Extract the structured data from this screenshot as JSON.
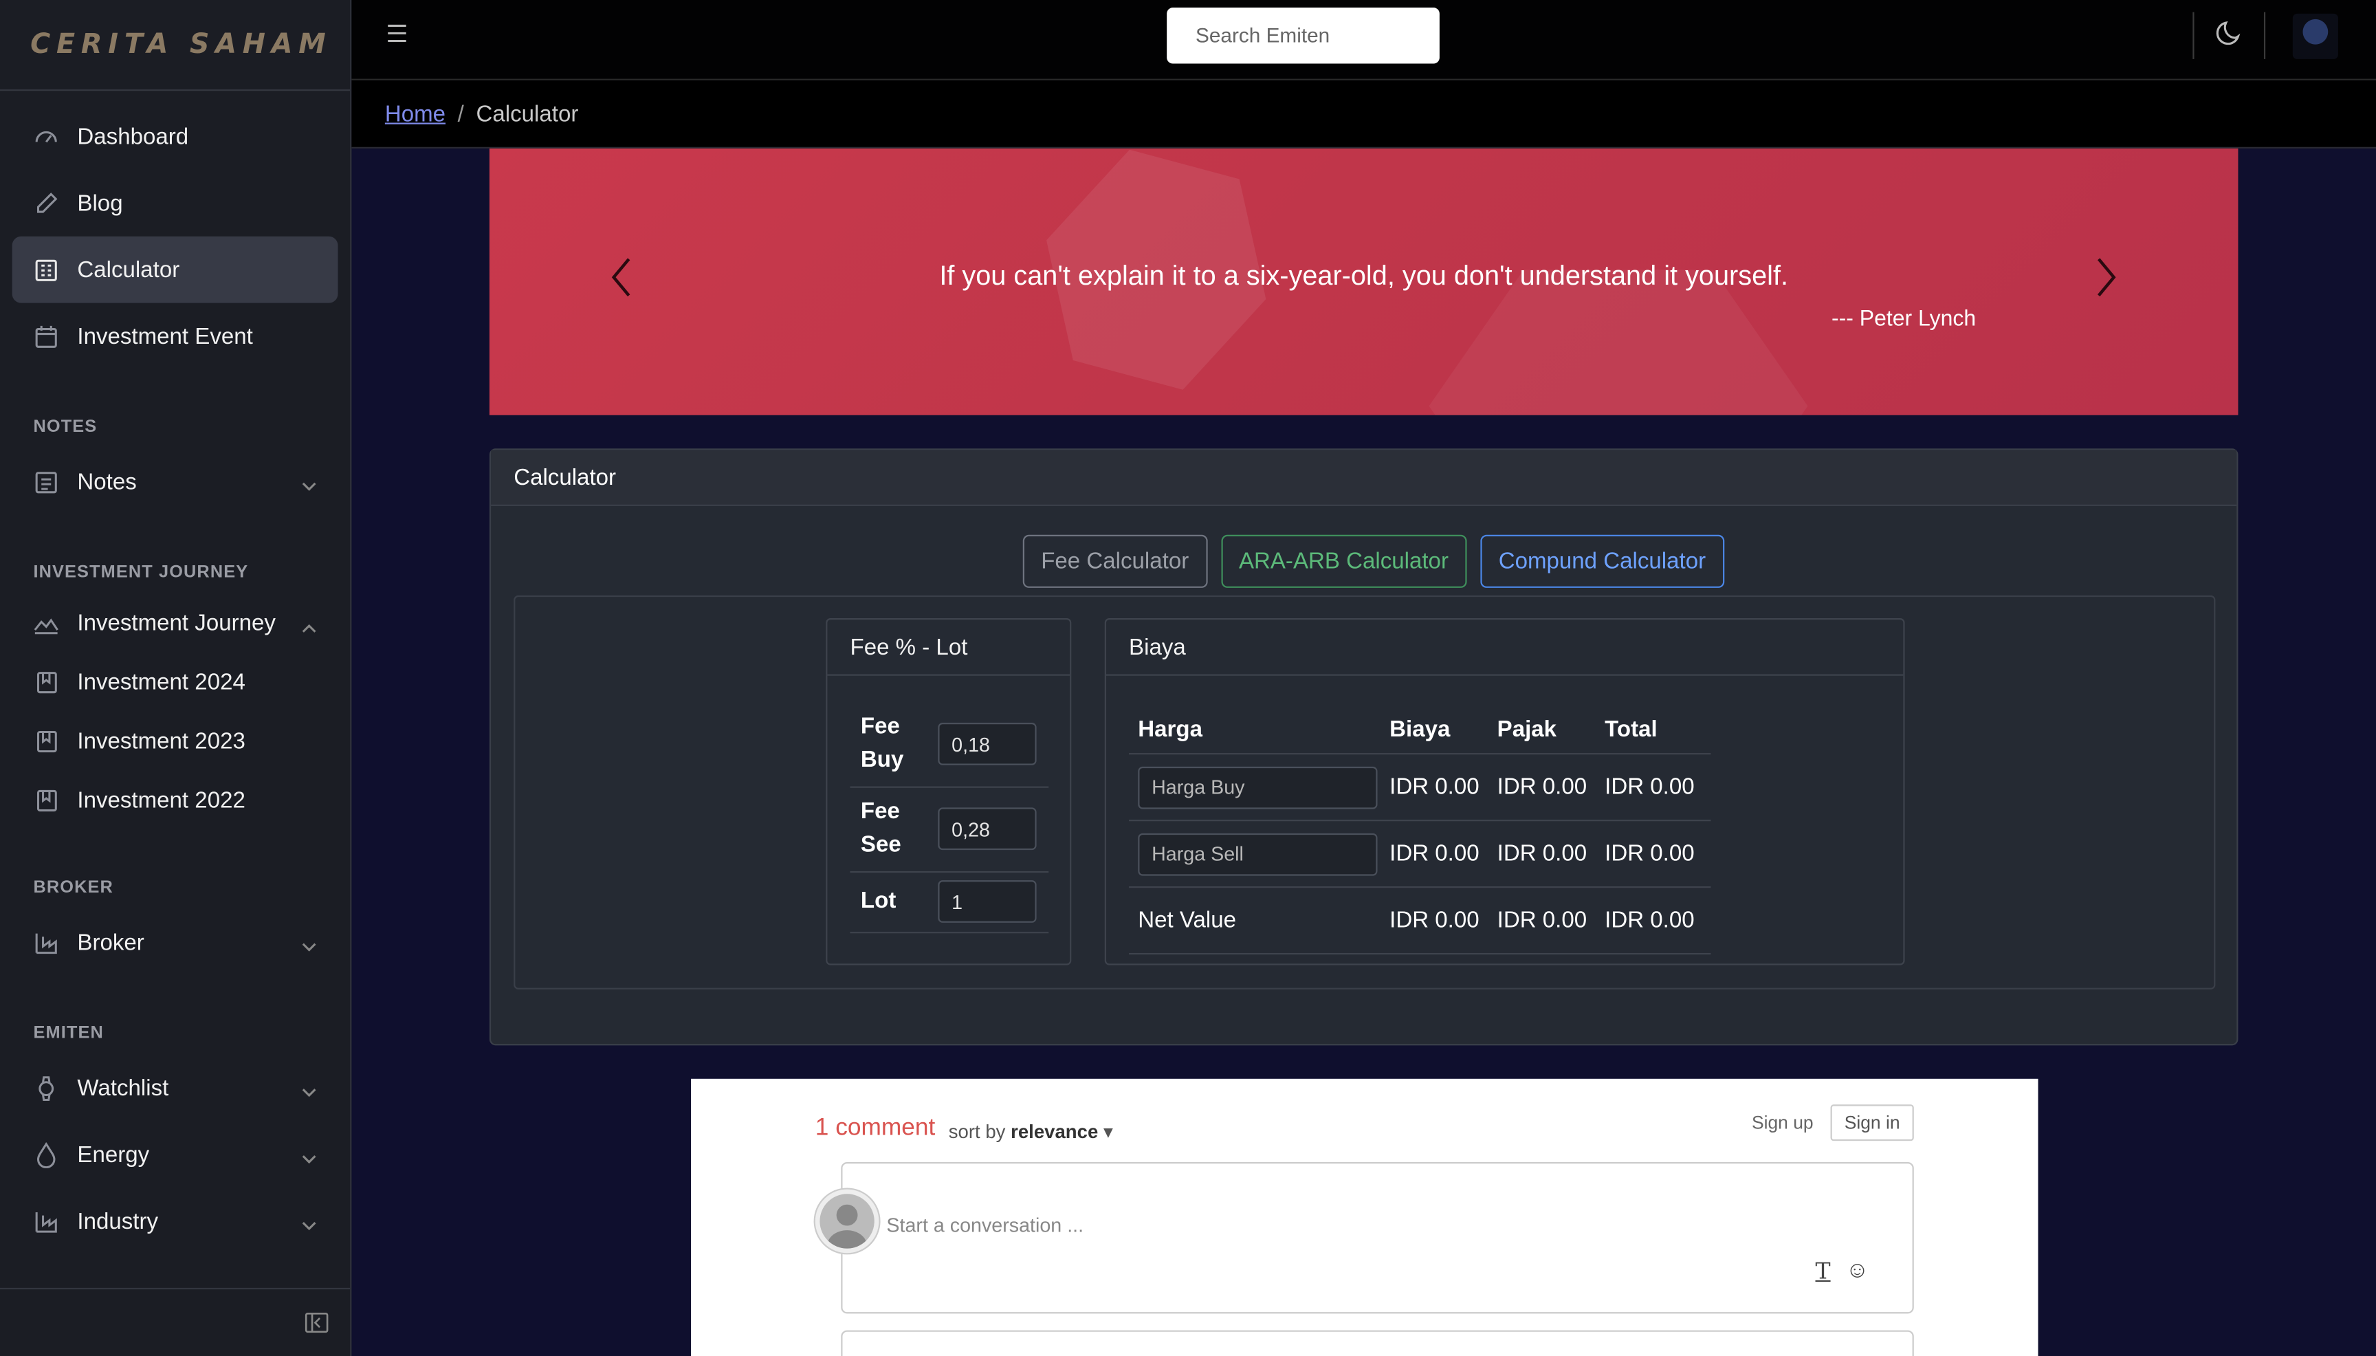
{
  "brand": "CERITA SAHAM",
  "sidebar": {
    "main": [
      {
        "label": "Dashboard"
      },
      {
        "label": "Blog"
      },
      {
        "label": "Calculator"
      },
      {
        "label": "Investment Event"
      }
    ],
    "sections": {
      "notes": "NOTES",
      "journey": "INVESTMENT JOURNEY",
      "broker": "BROKER",
      "emiten": "EMITEN"
    },
    "notes": "Notes",
    "journey": "Investment Journey",
    "journey_items": [
      "Investment 2024",
      "Investment 2023",
      "Investment 2022"
    ],
    "broker": "Broker",
    "emiten_items": [
      "Watchlist",
      "Energy",
      "Industry"
    ]
  },
  "header": {
    "search_placeholder": "Search Emiten"
  },
  "breadcrumb": {
    "home": "Home",
    "sep": "/",
    "current": "Calculator"
  },
  "banner": {
    "quote": "If you can't explain it to a six-year-old, you don't understand it yourself.",
    "author": "--- Peter Lynch"
  },
  "calculator": {
    "title": "Calculator",
    "tabs": [
      "Fee Calculator",
      "ARA-ARB Calculator",
      "Compund Calculator"
    ],
    "fee_card": {
      "title": "Fee % - Lot",
      "rows": [
        {
          "label": "Fee Buy",
          "value": "0,18"
        },
        {
          "label": "Fee See",
          "value": "0,28"
        },
        {
          "label": "Lot",
          "value": "1"
        }
      ]
    },
    "biaya_card": {
      "title": "Biaya",
      "headers": [
        "Harga",
        "Biaya",
        "Pajak",
        "Total"
      ],
      "rows": [
        {
          "placeholder": "Harga Buy",
          "biaya": "IDR 0.00",
          "pajak": "IDR 0.00",
          "total": "IDR 0.00"
        },
        {
          "placeholder": "Harga Sell",
          "biaya": "IDR 0.00",
          "pajak": "IDR 0.00",
          "total": "IDR 0.00"
        },
        {
          "label": "Net Value",
          "biaya": "IDR 0.00",
          "pajak": "IDR 0.00",
          "total": "IDR 0.00"
        }
      ]
    }
  },
  "comments": {
    "count": "1 comment",
    "sort_prefix": "sort by",
    "sort_value": "relevance",
    "signup": "Sign up",
    "signin": "Sign in",
    "placeholder": "Start a conversation ..."
  }
}
